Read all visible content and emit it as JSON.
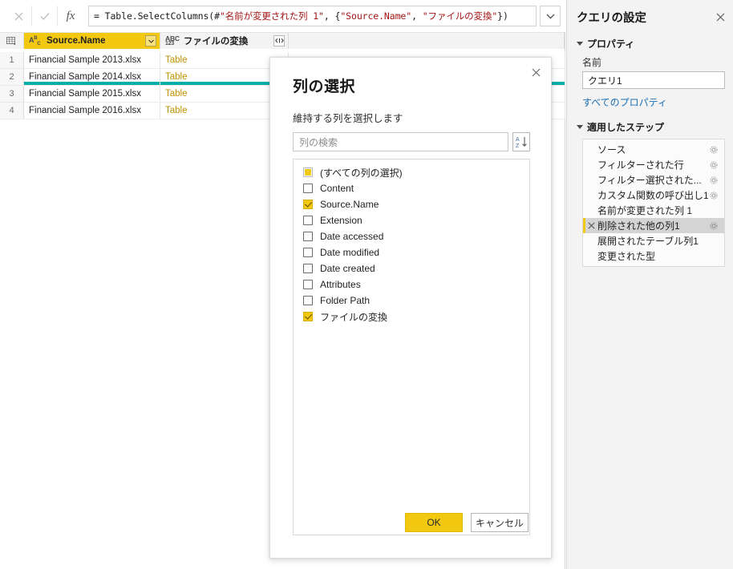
{
  "formula_bar": {
    "cancel_icon": "close-icon",
    "confirm_icon": "check-icon",
    "fx_label": "fx",
    "formula_prefix": "= Table.SelectColumns(#",
    "formula_arg1": "\"名前が変更された列 1\"",
    "formula_mid": ", {",
    "formula_arg2": "\"Source.Name\"",
    "formula_sep": ", ",
    "formula_arg3": "\"ファイルの変換\"",
    "formula_suffix": "})",
    "formula_full": "= Table.SelectColumns(#\"名前が変更された列 1\", {\"Source.Name\", \"ファイルの変換\"})",
    "expand_icon": "chevron-down-icon"
  },
  "grid": {
    "columns": [
      {
        "label": "Source.Name",
        "type_icon": "ABC",
        "type_sub": "",
        "selected": true,
        "control": "filter-dropdown"
      },
      {
        "label": "ファイルの変換",
        "type_icon": "ABC",
        "type_sub": "123",
        "selected": false,
        "control": "expand-columns"
      }
    ],
    "rows": [
      {
        "num": "1",
        "source_name": "Financial Sample 2013.xlsx",
        "table_cell": "Table"
      },
      {
        "num": "2",
        "source_name": "Financial Sample 2014.xlsx",
        "table_cell": "Table"
      },
      {
        "num": "3",
        "source_name": "Financial Sample 2015.xlsx",
        "table_cell": "Table"
      },
      {
        "num": "4",
        "source_name": "Financial Sample 2016.xlsx",
        "table_cell": "Table"
      }
    ],
    "accent_underline_color": "#00b0a8",
    "header_selected_color": "#f2c811"
  },
  "dialog": {
    "title": "列の選択",
    "subtitle": "維持する列を選択します",
    "search_placeholder": "列の検索",
    "search_value": "",
    "sort_icon": "sort-az-icon",
    "close_icon": "close-icon",
    "items": [
      {
        "label": "(すべての列の選択)",
        "state": "partial"
      },
      {
        "label": "Content",
        "state": "unchecked"
      },
      {
        "label": "Source.Name",
        "state": "checked"
      },
      {
        "label": "Extension",
        "state": "unchecked"
      },
      {
        "label": "Date accessed",
        "state": "unchecked"
      },
      {
        "label": "Date modified",
        "state": "unchecked"
      },
      {
        "label": "Date created",
        "state": "unchecked"
      },
      {
        "label": "Attributes",
        "state": "unchecked"
      },
      {
        "label": "Folder Path",
        "state": "unchecked"
      },
      {
        "label": "ファイルの変換",
        "state": "checked"
      }
    ],
    "ok_label": "OK",
    "cancel_label": "キャンセル"
  },
  "query_settings": {
    "title": "クエリの設定",
    "close_icon": "close-icon",
    "properties_heading": "プロパティ",
    "name_label": "名前",
    "name_value": "クエリ1",
    "all_properties_link": "すべてのプロパティ",
    "steps_heading": "適用したステップ",
    "steps": [
      {
        "label": "ソース",
        "active": false,
        "gear": true,
        "deletable": false
      },
      {
        "label": "フィルターされた行",
        "active": false,
        "gear": true,
        "deletable": false
      },
      {
        "label": "フィルター選択された...",
        "active": false,
        "gear": true,
        "deletable": false
      },
      {
        "label": "カスタム関数の呼び出し1",
        "active": false,
        "gear": true,
        "deletable": false
      },
      {
        "label": "名前が変更された列 1",
        "active": false,
        "gear": false,
        "deletable": false
      },
      {
        "label": "削除された他の列1",
        "active": true,
        "gear": true,
        "deletable": true
      },
      {
        "label": "展開されたテーブル列1",
        "active": false,
        "gear": false,
        "deletable": false
      },
      {
        "label": "変更された型",
        "active": false,
        "gear": false,
        "deletable": false
      }
    ],
    "accent_color": "#f2c811"
  }
}
